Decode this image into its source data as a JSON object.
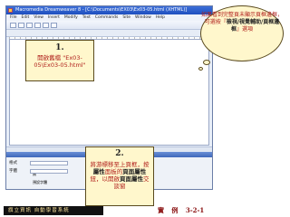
{
  "window": {
    "title": "Macromedia Dreamweaver 8 - [C:\\Documents\\EX03\\Ex03-05.html (XHTML)]",
    "menu": [
      "File",
      "Edit",
      "View",
      "Insert",
      "Modify",
      "Text",
      "Commands",
      "Site",
      "Window",
      "Help"
    ]
  },
  "properties_panel": {
    "rows": [
      {
        "label": "格式",
        "value1": "無",
        "value2": "無"
      },
      {
        "label": "字體",
        "value1": "預設字體",
        "value2": ""
      }
    ]
  },
  "callouts": {
    "step1": {
      "number": "1.",
      "text": "開啟舊檔 \"Ex03-05\\Ex03-05.html\""
    },
    "step2": {
      "number": "2.",
      "text_a": "將游標移至上頁框，按",
      "text_b": "屬性",
      "text_c": "面板的",
      "text_d": "頁面屬性",
      "text_e": "鈕，以開啟",
      "text_f": "頁面屬性",
      "text_g": "交談窗"
    },
    "tip": {
      "text_a": "如果看到完整頁未顯示頁框邊框，可選按『",
      "text_b": "檢視/視覺輔助/頁框邊框",
      "text_c": "』選項"
    }
  },
  "footer": {
    "left": "旗立資訊 自動學習系統",
    "center": "實 例 3-2-1"
  }
}
